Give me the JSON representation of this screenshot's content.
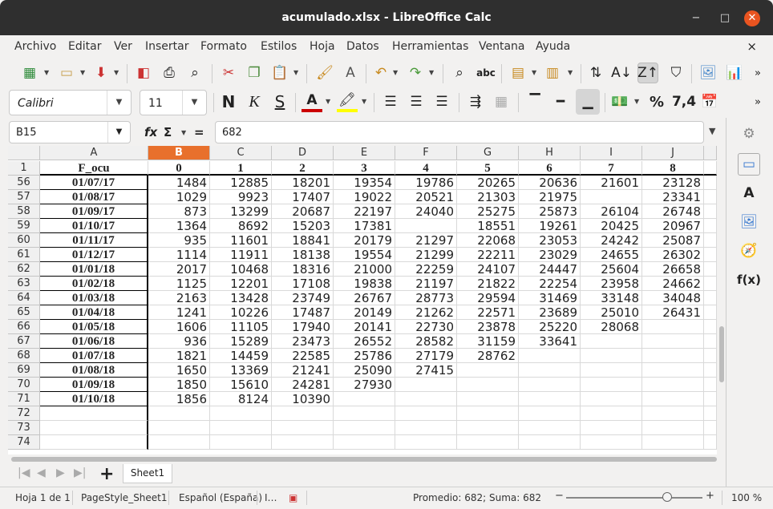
{
  "window": {
    "title": "acumulado.xlsx - LibreOffice Calc",
    "minimize": "−",
    "maximize": "□",
    "close": "✕"
  },
  "menu": [
    "Archivo",
    "Editar",
    "Ver",
    "Insertar",
    "Formato",
    "Estilos",
    "Hoja",
    "Datos",
    "Herramientas",
    "Ventana",
    "Ayuda"
  ],
  "doc_close": "×",
  "font": {
    "name": "Calibri",
    "size": "11"
  },
  "format_buttons": {
    "bold": "N",
    "italic": "K",
    "underline": "S",
    "percent": "%",
    "decimal": "7,4"
  },
  "namebox": "B15",
  "formula_value": "682",
  "formula_symbols": {
    "fx": "fx",
    "sigma": "Σ",
    "equals": "="
  },
  "columns": [
    {
      "id": "A",
      "selected": false
    },
    {
      "id": "B",
      "selected": true
    },
    {
      "id": "C",
      "selected": false
    },
    {
      "id": "D",
      "selected": false
    },
    {
      "id": "E",
      "selected": false
    },
    {
      "id": "F",
      "selected": false
    },
    {
      "id": "G",
      "selected": false
    },
    {
      "id": "H",
      "selected": false
    },
    {
      "id": "I",
      "selected": false
    },
    {
      "id": "J",
      "selected": false
    }
  ],
  "rows": [
    {
      "num": "1",
      "date": "F_ocu",
      "values": [
        "0",
        "1",
        "2",
        "3",
        "4",
        "5",
        "6",
        "7",
        "8"
      ],
      "header": true
    },
    {
      "num": "56",
      "date": "01/07/17",
      "values": [
        "1484",
        "12885",
        "18201",
        "19354",
        "19786",
        "20265",
        "20636",
        "21601",
        "23128"
      ]
    },
    {
      "num": "57",
      "date": "01/08/17",
      "values": [
        "1029",
        "9923",
        "17407",
        "19022",
        "20521",
        "21303",
        "21975",
        "",
        "23341"
      ]
    },
    {
      "num": "58",
      "date": "01/09/17",
      "values": [
        "873",
        "13299",
        "20687",
        "22197",
        "24040",
        "25275",
        "25873",
        "26104",
        "26748"
      ]
    },
    {
      "num": "59",
      "date": "01/10/17",
      "values": [
        "1364",
        "8692",
        "15203",
        "17381",
        "",
        "18551",
        "19261",
        "20425",
        "20967"
      ]
    },
    {
      "num": "60",
      "date": "01/11/17",
      "values": [
        "935",
        "11601",
        "18841",
        "20179",
        "21297",
        "22068",
        "23053",
        "24242",
        "25087"
      ]
    },
    {
      "num": "61",
      "date": "01/12/17",
      "values": [
        "1114",
        "11911",
        "18138",
        "19554",
        "21299",
        "22211",
        "23029",
        "24655",
        "26302"
      ]
    },
    {
      "num": "62",
      "date": "01/01/18",
      "values": [
        "2017",
        "10468",
        "18316",
        "21000",
        "22259",
        "24107",
        "24447",
        "25604",
        "26658"
      ]
    },
    {
      "num": "63",
      "date": "01/02/18",
      "values": [
        "1125",
        "12201",
        "17108",
        "19838",
        "21197",
        "21822",
        "22254",
        "23958",
        "24662"
      ]
    },
    {
      "num": "64",
      "date": "01/03/18",
      "values": [
        "2163",
        "13428",
        "23749",
        "26767",
        "28773",
        "29594",
        "31469",
        "33148",
        "34048"
      ]
    },
    {
      "num": "65",
      "date": "01/04/18",
      "values": [
        "1241",
        "10226",
        "17487",
        "20149",
        "21262",
        "22571",
        "23689",
        "25010",
        "26431"
      ]
    },
    {
      "num": "66",
      "date": "01/05/18",
      "values": [
        "1606",
        "11105",
        "17940",
        "20141",
        "22730",
        "23878",
        "25220",
        "28068",
        ""
      ]
    },
    {
      "num": "67",
      "date": "01/06/18",
      "values": [
        "936",
        "15289",
        "23473",
        "26552",
        "28582",
        "31159",
        "33641",
        "",
        ""
      ]
    },
    {
      "num": "68",
      "date": "01/07/18",
      "values": [
        "1821",
        "14459",
        "22585",
        "25786",
        "27179",
        "28762",
        "",
        "",
        ""
      ]
    },
    {
      "num": "69",
      "date": "01/08/18",
      "values": [
        "1650",
        "13369",
        "21241",
        "25090",
        "27415",
        "",
        "",
        "",
        ""
      ]
    },
    {
      "num": "70",
      "date": "01/09/18",
      "values": [
        "1850",
        "15610",
        "24281",
        "27930",
        "",
        "",
        "",
        "",
        ""
      ]
    },
    {
      "num": "71",
      "date": "01/10/18",
      "values": [
        "1856",
        "8124",
        "10390",
        "",
        "",
        "",
        "",
        "",
        ""
      ]
    },
    {
      "num": "72",
      "date": "",
      "values": [
        "",
        "",
        "",
        "",
        "",
        "",
        "",
        "",
        ""
      ]
    },
    {
      "num": "73",
      "date": "",
      "values": [
        "",
        "",
        "",
        "",
        "",
        "",
        "",
        "",
        ""
      ]
    },
    {
      "num": "74",
      "date": "",
      "values": [
        "",
        "",
        "",
        "",
        "",
        "",
        "",
        "",
        ""
      ]
    }
  ],
  "sheet_tab": "Sheet1",
  "add_sheet": "+",
  "status": {
    "sheet": "Hoja 1 de 1",
    "page_style": "PageStyle_Sheet1",
    "language": "Español (España)",
    "selection_mode": "I…",
    "summary": "Promedio: 682; Suma: 682",
    "zoom": "100 %"
  }
}
